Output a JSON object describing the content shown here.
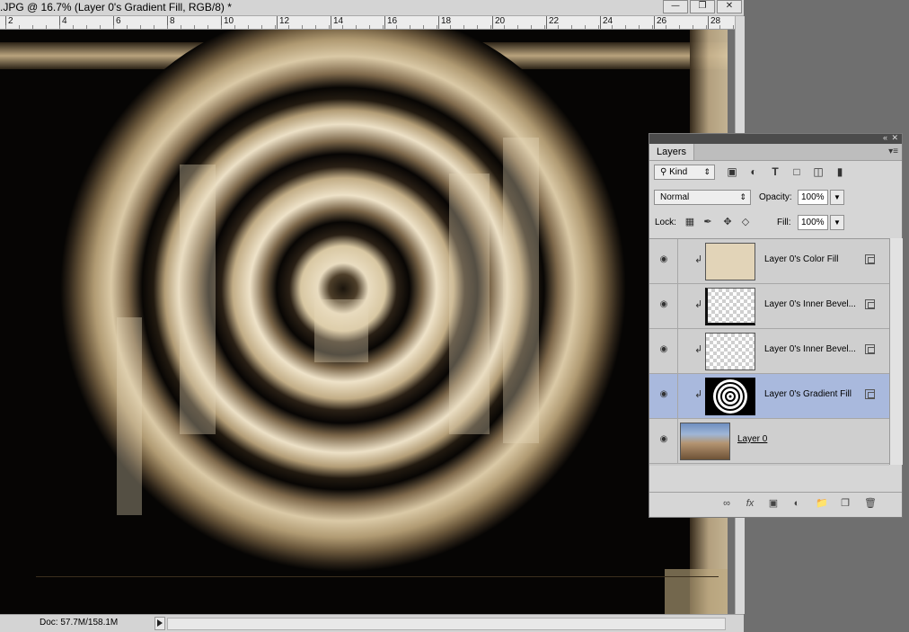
{
  "window": {
    "title": ".JPG @ 16.7% (Layer 0's Gradient Fill, RGB/8) *",
    "minimize_icon": "minimize-icon",
    "maximize_icon": "maximize-icon",
    "close_icon": "close-icon"
  },
  "ruler": {
    "labels": [
      "2",
      "4",
      "6",
      "8",
      "10",
      "12",
      "14",
      "16",
      "18",
      "20",
      "22",
      "24",
      "26",
      "28"
    ]
  },
  "status": {
    "doc_info": "Doc: 57.7M/158.1M"
  },
  "layers_panel": {
    "tab_label": "Layers",
    "filter_kind": "Kind",
    "blend_mode": "Normal",
    "opacity_label": "Opacity:",
    "opacity_value": "100%",
    "lock_label": "Lock:",
    "fill_label": "Fill:",
    "fill_value": "100%",
    "layers": [
      {
        "name": "Layer 0's Color Fill",
        "clipped": true,
        "thumb": "color-fill",
        "selected": false
      },
      {
        "name": "Layer 0's Inner Bevel...",
        "clipped": true,
        "thumb": "transparent-bevel",
        "selected": false
      },
      {
        "name": "Layer 0's Inner Bevel...",
        "clipped": true,
        "thumb": "transparent",
        "selected": false
      },
      {
        "name": "Layer 0's Gradient Fill",
        "clipped": true,
        "thumb": "rings",
        "selected": true
      },
      {
        "name": "Layer 0",
        "clipped": false,
        "thumb": "photo",
        "selected": false
      }
    ]
  },
  "colors": {
    "sepia_light": "#efe2c8",
    "sepia_mid": "#c9b48b",
    "sepia_dark": "#6d5a3c",
    "color_fill_swatch": "#e2d4b8",
    "selection_blue": "#a9b9dd"
  }
}
